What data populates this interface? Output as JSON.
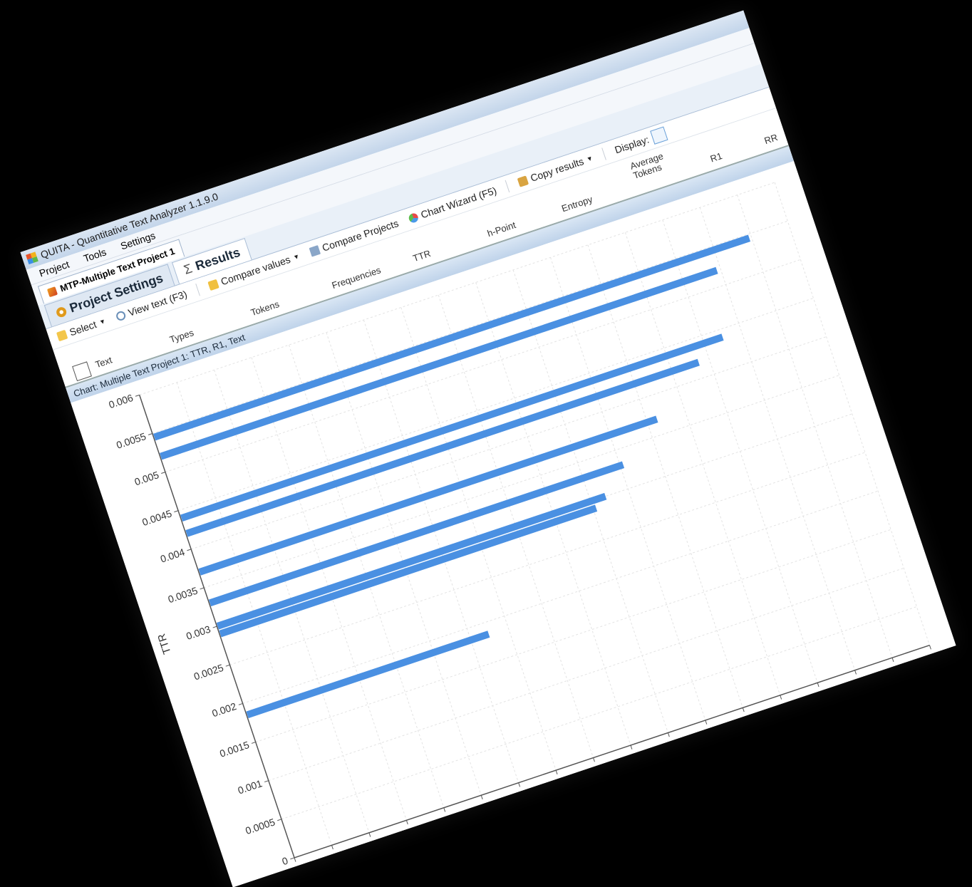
{
  "window": {
    "title": "QUITA - Quantitative Text Analyzer 1.1.9.0"
  },
  "menu": {
    "items": [
      "Project",
      "Tools",
      "Settings"
    ]
  },
  "project_tab": {
    "label": "MTP-Multiple Text Project 1"
  },
  "subtabs": {
    "settings": "Project Settings",
    "results": "Results"
  },
  "toolbar": {
    "select": "Select",
    "view_text": "View text (F3)",
    "compare_values": "Compare values",
    "compare_projects": "Compare Projects",
    "chart_wizard": "Chart Wizard (F5)",
    "copy_results": "Copy results",
    "display": "Display:"
  },
  "grid": {
    "columns": [
      "Text",
      "Types",
      "Tokens",
      "Frequencies",
      "TTR",
      "h-Point",
      "Entropy",
      "Average Tokens",
      "R1",
      "RR"
    ]
  },
  "chart_panel": {
    "title": "Chart: Multiple Text Project 1: TTR, R1, Text"
  },
  "chart_data": {
    "type": "bar",
    "orientation": "horizontal",
    "ylabel": "TTR",
    "xlabel": "",
    "xlim": [
      0,
      0.085
    ],
    "ylim": [
      0,
      0.006
    ],
    "x_ticks": [
      "0",
      "0.005",
      "0.01",
      "0.015",
      "0.02",
      "0.025",
      "0.03",
      "0.035",
      "0.04",
      "0.045",
      "0.05",
      "0.055",
      "0.06",
      "0.065",
      "0.07",
      "0.075",
      "0.08",
      "0.085"
    ],
    "y_ticks": [
      "0",
      "0.0005",
      "0.001",
      "0.0015",
      "0.002",
      "0.0025",
      "0.003",
      "0.0035",
      "0.004",
      "0.0045",
      "0.005",
      "0.0055",
      "0.006"
    ],
    "grid": true,
    "bar_color": "#4a90e2",
    "bars": [
      {
        "ttr": 0.00545,
        "r1": 0.0797
      },
      {
        "ttr": 0.0052,
        "r1": 0.0745
      },
      {
        "ttr": 0.0044,
        "r1": 0.0725
      },
      {
        "ttr": 0.0042,
        "r1": 0.0686
      },
      {
        "ttr": 0.0037,
        "r1": 0.0613
      },
      {
        "ttr": 0.0033,
        "r1": 0.0554
      },
      {
        "ttr": 0.003,
        "r1": 0.052
      },
      {
        "ttr": 0.0029,
        "r1": 0.0504
      },
      {
        "ttr": 0.00185,
        "r1": 0.0324
      }
    ]
  }
}
